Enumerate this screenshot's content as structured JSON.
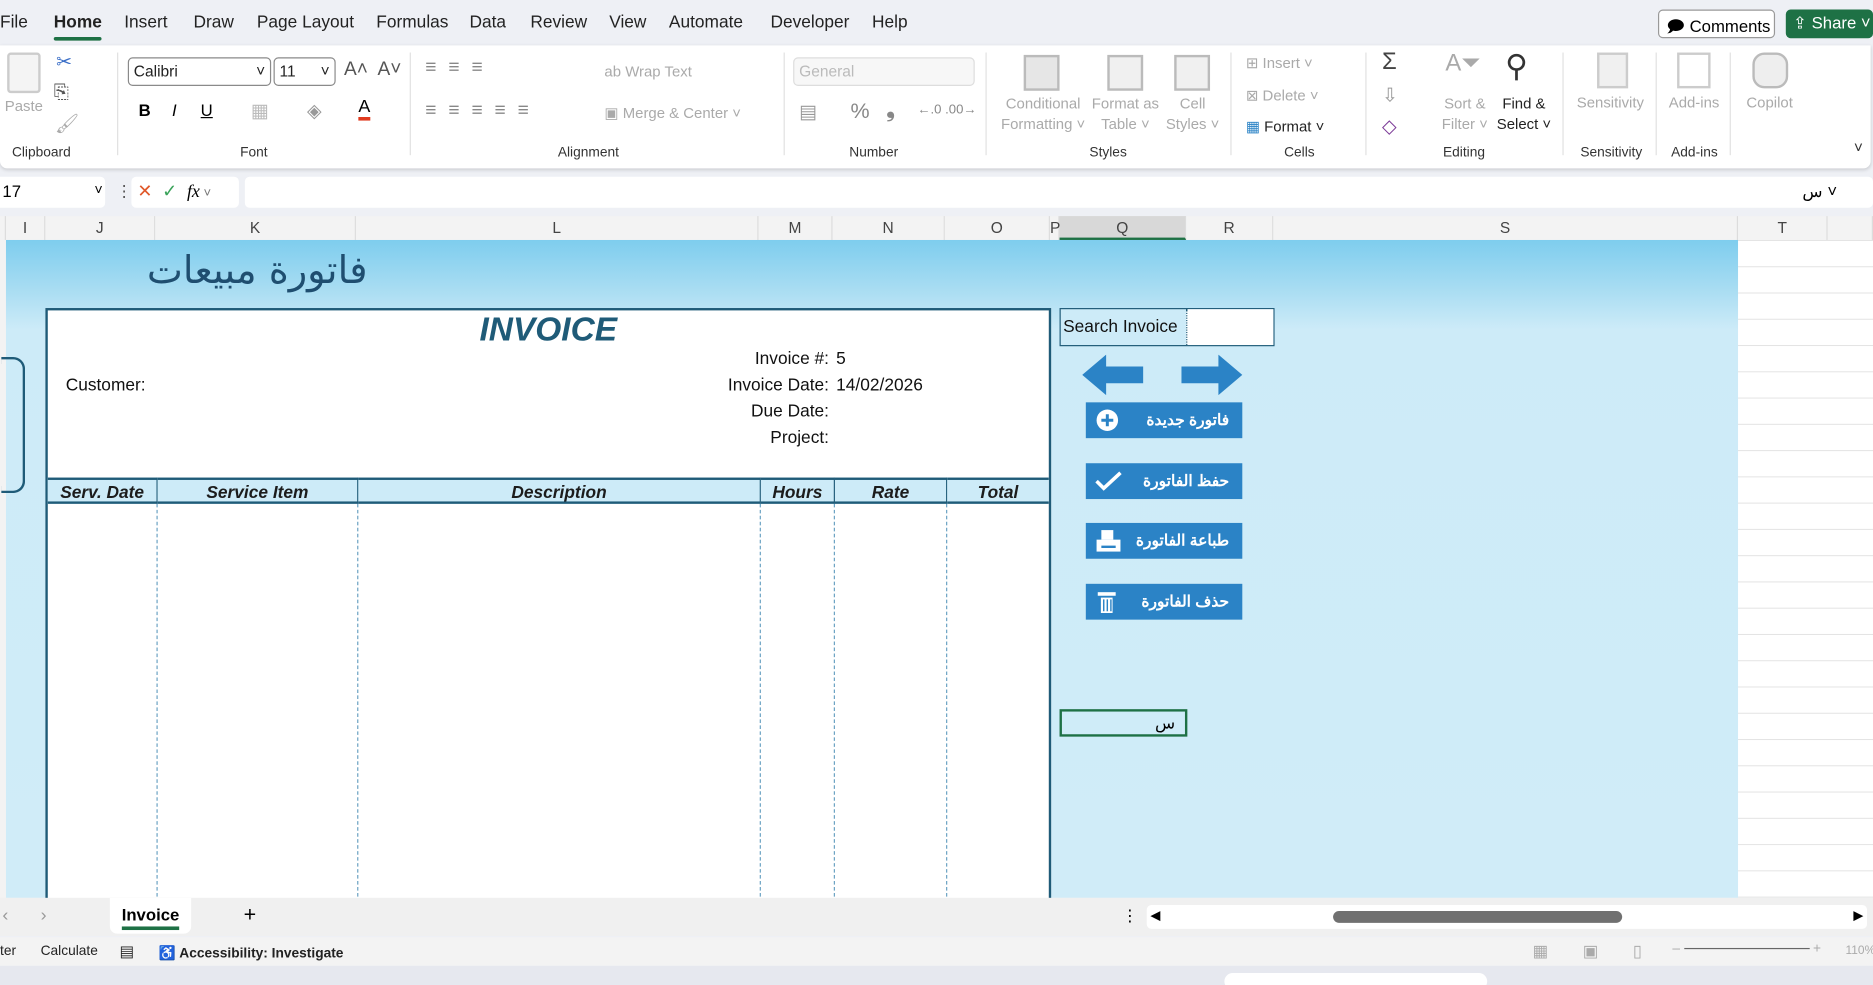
{
  "menu": [
    "File",
    "Home",
    "Insert",
    "Draw",
    "Page Layout",
    "Formulas",
    "Data",
    "Review",
    "View",
    "Automate",
    "Developer",
    "Help"
  ],
  "active_menu": "Home",
  "top_buttons": {
    "comments": "Comments",
    "share": "Share"
  },
  "ribbon": {
    "clipboard": {
      "paste": "Paste",
      "label": "Clipboard"
    },
    "font": {
      "name": "Calibri",
      "size": "11",
      "label": "Font",
      "bold": "B",
      "italic": "I",
      "underline": "U"
    },
    "alignment": {
      "wrap": "Wrap Text",
      "merge": "Merge & Center",
      "label": "Alignment"
    },
    "number": {
      "format": "General",
      "label": "Number",
      "percent": "%"
    },
    "styles": {
      "conditional": "Conditional",
      "conditional2": "Formatting",
      "table": "Format as",
      "table2": "Table",
      "cell": "Cell",
      "cell2": "Styles",
      "label": "Styles"
    },
    "cells": {
      "insert": "Insert",
      "delete": "Delete",
      "format": "Format",
      "label": "Cells"
    },
    "editing": {
      "sort": "Sort &",
      "sort2": "Filter",
      "find": "Find &",
      "find2": "Select",
      "label": "Editing",
      "sum": "Σ"
    },
    "sensitivity": {
      "btn": "Sensitivity",
      "label": "Sensitivity"
    },
    "addins": {
      "btn": "Add-ins",
      "label": "Add-ins"
    },
    "copilot": "Copilot"
  },
  "formula_bar": {
    "name_box": "17",
    "fx": "fx",
    "content": "س"
  },
  "columns": [
    "I",
    "J",
    "K",
    "L",
    "M",
    "N",
    "O",
    "P",
    "Q",
    "R",
    "S",
    "T"
  ],
  "selected_column": "Q",
  "sheet": {
    "arabic_title": "فاتورة مبيعات",
    "invoice_title": "INVOICE",
    "customer_label": "Customer:",
    "invoice_no_label": "Invoice #:",
    "invoice_no": "5",
    "invoice_date_label": "Invoice Date:",
    "invoice_date": "14/02/2026",
    "due_date_label": "Due Date:",
    "project_label": "Project:",
    "table_headers": [
      "Serv. Date",
      "Service Item",
      "Description",
      "Hours",
      "Rate",
      "Total"
    ],
    "search_label": "Search Invoice",
    "search_value": "",
    "buttons": {
      "new": "فاتورة جديدة",
      "save": "حفظ الفاتورة",
      "print": "طباعة الفاتورة",
      "delete": "حذف الفاتورة"
    },
    "active_cell_value": "س",
    "button_color": "#2b83c6",
    "border_color": "#1f5b78"
  },
  "sheet_tabs": [
    "Invoice"
  ],
  "status": {
    "left": "ter",
    "calculate": "Calculate",
    "accessibility": "Accessibility: Investigate",
    "zoom": "110%"
  }
}
